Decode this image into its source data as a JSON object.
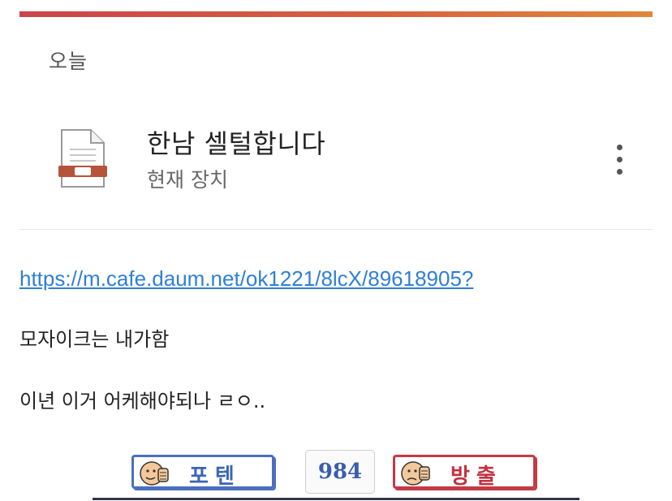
{
  "section": {
    "label": "오늘"
  },
  "file": {
    "title": "한남 셀털합니다",
    "subtitle": "현재 장치",
    "icon": "document-icon",
    "more_icon": "more-vertical-icon"
  },
  "post": {
    "link": "https://m.cafe.daum.net/ok1221/8lcX/89618905?",
    "lines": [
      "모자이크는 내가함",
      "이년 이거 어케해야되나 ㄹㅇ.."
    ]
  },
  "votes": {
    "up_label": "포텐",
    "count": "984",
    "down_label": "방출",
    "up_color": "#3b64b6",
    "down_color": "#c43040"
  },
  "colors": {
    "accent_start": "#c9454b",
    "accent_end": "#e0873b",
    "link": "#2f7fd6"
  }
}
